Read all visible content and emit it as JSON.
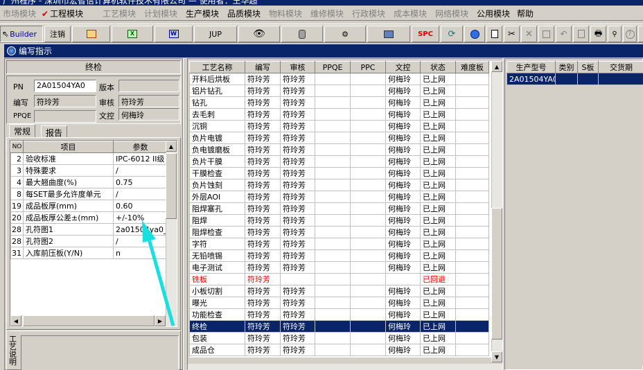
{
  "titlebar": {
    "text": "广州程序 - 深圳市宏智信计算机软件技术有限公司 — 使用者：王华超"
  },
  "menu": [
    {
      "label": "市场模块",
      "dim": true
    },
    {
      "label": "工程模块",
      "dim": false,
      "checked": true
    },
    {
      "label": "工艺模块",
      "dim": true
    },
    {
      "label": "计划模块",
      "dim": true
    },
    {
      "label": "生产模块",
      "dim": false
    },
    {
      "label": "品质模块",
      "dim": false
    },
    {
      "label": "物料模块",
      "dim": true
    },
    {
      "label": "维修模块",
      "dim": true
    },
    {
      "label": "行政模块",
      "dim": true
    },
    {
      "label": "成本模块",
      "dim": true
    },
    {
      "label": "网络模块",
      "dim": true
    },
    {
      "label": "公用模块",
      "dim": false
    },
    {
      "label": "帮助",
      "dim": false
    }
  ],
  "toolbar": {
    "builder_label": "Builder",
    "logout_label": "注销",
    "jup_label": "JUP",
    "spc_label": "SPC"
  },
  "window": {
    "title": "编写指示"
  },
  "left": {
    "header": "终检",
    "pn_label": "PN",
    "pn_value": "2A01504YA0",
    "version_label": "版本",
    "version_value": "",
    "writer_label": "编写",
    "writer_value": "符玲芳",
    "reviewer_label": "审核",
    "reviewer_value": "符玲芳",
    "ppqe_label": "PPQE",
    "ppqe_value": "",
    "control_label": "文控",
    "control_value": "何梅玲",
    "tabs": [
      "常规",
      "报告"
    ],
    "param_headers": [
      "NO",
      "项目",
      "参数"
    ],
    "params": [
      {
        "no": "2",
        "item": "验收标准",
        "value": "IPC-6012 II级"
      },
      {
        "no": "3",
        "item": "特殊要求",
        "value": "/"
      },
      {
        "no": "4",
        "item": "最大翘曲度(%)",
        "value": "0.75"
      },
      {
        "no": "8",
        "item": "每SET最多允许度单元",
        "value": "/"
      },
      {
        "no": "19",
        "item": "成品板厚(mm)",
        "value": "0.60"
      },
      {
        "no": "20",
        "item": "成品板厚公差±(mm)",
        "value": "+/-10%"
      },
      {
        "no": "28",
        "item": "孔符图1",
        "value": "2a01504ya0_dr"
      },
      {
        "no": "28",
        "item": "孔符图2",
        "value": "/"
      },
      {
        "no": "31",
        "item": "入库前压板(Y/N)",
        "value": "n"
      }
    ],
    "side_label": "工艺说明"
  },
  "process": {
    "headers": [
      "工艺名称",
      "编写",
      "审核",
      "PPQE",
      "PPC",
      "文控",
      "状态",
      "难度板"
    ],
    "rows": [
      [
        "开料后烘板",
        "符玲芳",
        "符玲芳",
        "",
        "",
        "何梅玲",
        "已上网",
        ""
      ],
      [
        "铝片钻孔",
        "符玲芳",
        "符玲芳",
        "",
        "",
        "何梅玲",
        "已上网",
        ""
      ],
      [
        "钻孔",
        "符玲芳",
        "符玲芳",
        "",
        "",
        "何梅玲",
        "已上网",
        ""
      ],
      [
        "去毛刺",
        "符玲芳",
        "符玲芳",
        "",
        "",
        "何梅玲",
        "已上网",
        ""
      ],
      [
        "沉铜",
        "符玲芳",
        "符玲芳",
        "",
        "",
        "何梅玲",
        "已上网",
        ""
      ],
      [
        "负片电镀",
        "符玲芳",
        "符玲芳",
        "",
        "",
        "何梅玲",
        "已上网",
        ""
      ],
      [
        "负电镀磨板",
        "符玲芳",
        "符玲芳",
        "",
        "",
        "何梅玲",
        "已上网",
        ""
      ],
      [
        "负片干膜",
        "符玲芳",
        "符玲芳",
        "",
        "",
        "何梅玲",
        "已上网",
        ""
      ],
      [
        "干膜检查",
        "符玲芳",
        "符玲芳",
        "",
        "",
        "何梅玲",
        "已上网",
        ""
      ],
      [
        "负片蚀刻",
        "符玲芳",
        "符玲芳",
        "",
        "",
        "何梅玲",
        "已上网",
        ""
      ],
      [
        "外层AOI",
        "符玲芳",
        "符玲芳",
        "",
        "",
        "何梅玲",
        "已上网",
        ""
      ],
      [
        "阻焊塞孔",
        "符玲芳",
        "符玲芳",
        "",
        "",
        "何梅玲",
        "已上网",
        ""
      ],
      [
        "阻焊",
        "符玲芳",
        "符玲芳",
        "",
        "",
        "何梅玲",
        "已上网",
        ""
      ],
      [
        "阻焊检查",
        "符玲芳",
        "符玲芳",
        "",
        "",
        "何梅玲",
        "已上网",
        ""
      ],
      [
        "字符",
        "符玲芳",
        "符玲芳",
        "",
        "",
        "何梅玲",
        "已上网",
        ""
      ],
      [
        "无铅喷锡",
        "符玲芳",
        "符玲芳",
        "",
        "",
        "何梅玲",
        "已上网",
        ""
      ],
      [
        "电子测试",
        "符玲芳",
        "符玲芳",
        "",
        "",
        "何梅玲",
        "已上网",
        ""
      ],
      [
        "铣板",
        "符玲芳",
        "",
        "",
        "",
        "",
        "已回退",
        ""
      ],
      [
        "小板切割",
        "符玲芳",
        "符玲芳",
        "",
        "",
        "何梅玲",
        "已上网",
        ""
      ],
      [
        "曝光",
        "符玲芳",
        "符玲芳",
        "",
        "",
        "何梅玲",
        "已上网",
        ""
      ],
      [
        "功能检查",
        "符玲芳",
        "符玲芳",
        "",
        "",
        "何梅玲",
        "已上网",
        ""
      ],
      [
        "终检",
        "符玲芳",
        "符玲芳",
        "",
        "",
        "何梅玲",
        "已上网",
        ""
      ],
      [
        "包装",
        "符玲芳",
        "符玲芳",
        "",
        "",
        "何梅玲",
        "已上网",
        ""
      ],
      [
        "成品仓",
        "符玲芳",
        "符玲芳",
        "",
        "",
        "何梅玲",
        "已上网",
        ""
      ]
    ],
    "selected_index": 21,
    "rejected_index": 17
  },
  "orders": {
    "headers": [
      "生产型号",
      "类别",
      "S板",
      "交货期"
    ],
    "rows": [
      [
        "2A01504YA0",
        "",
        "",
        ""
      ]
    ]
  },
  "colors": {
    "selection": "#0a246a",
    "rejected": "#ff0000",
    "arrow": "#19e0e0"
  }
}
